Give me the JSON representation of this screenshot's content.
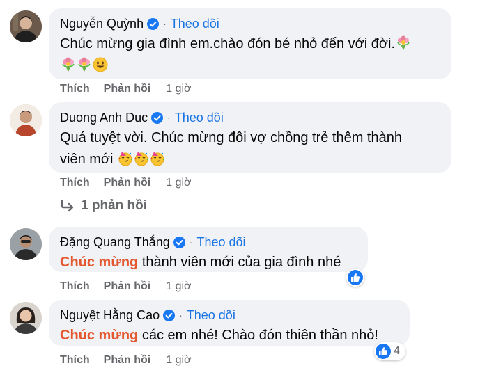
{
  "labels": {
    "follow": "Theo dõi",
    "like": "Thích",
    "reply": "Phản hồi",
    "dot": "·"
  },
  "comments": [
    {
      "author": "Nguyễn Quỳnh",
      "text_line1": "Chúc mừng gia đình em.chào đón bé nhỏ đến với đời.",
      "time": "1 giờ"
    },
    {
      "author": "Duong Anh Duc",
      "text_line1": "Quá tuyệt vời. Chúc mừng đôi vợ chồng trẻ thêm thành",
      "text_line2": "viên mới",
      "time": "1 giờ"
    },
    {
      "author": "Đặng Quang Thắng",
      "highlight": "Chúc mừng",
      "text_rest": " thành viên mới của gia đình nhé",
      "time": "1 giờ"
    },
    {
      "author": "Nguyệt Hằng Cao",
      "highlight": "Chúc mừng",
      "text_rest": " các em nhé! Chào đón thiên thần nhỏ!",
      "time": "1 giờ",
      "reaction_count": "4"
    }
  ],
  "replies_link": "1 phản hồi",
  "icons": {
    "verified": "verified-badge-icon",
    "bouquet": "bouquet-emoji-icon",
    "smile": "grinning-face-emoji-icon",
    "party": "partying-face-emoji-icon",
    "reply_arrow": "reply-arrow-icon",
    "like": "like-thumb-icon"
  },
  "colors": {
    "bubble": "#f0f2f5",
    "link": "#1b74e4",
    "muted": "#65676b",
    "highlight": "#e4572e",
    "badge": "#1877f2"
  }
}
